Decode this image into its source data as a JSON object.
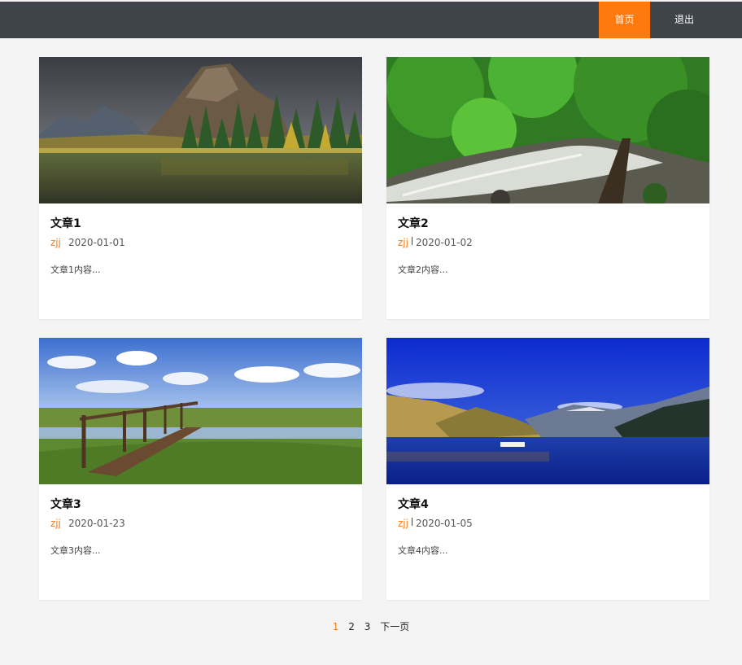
{
  "nav": {
    "home": "首页",
    "logout": "退出"
  },
  "articles": [
    {
      "title": "文章1",
      "author": "zjj",
      "date": "2020-01-01",
      "excerpt": "文章1内容..."
    },
    {
      "title": "文章2",
      "author": "zjj",
      "date": "2020-01-02",
      "excerpt": "文章2内容..."
    },
    {
      "title": "文章3",
      "author": "zjj",
      "date": "2020-01-23",
      "excerpt": "文章3内容..."
    },
    {
      "title": "文章4",
      "author": "zjj",
      "date": "2020-01-05",
      "excerpt": "文章4内容..."
    }
  ],
  "pagination": {
    "pages": [
      "1",
      "2",
      "3"
    ],
    "current": "1",
    "next": "下一页"
  },
  "colors": {
    "topbar": "#3f434a",
    "accent": "#ff7a0e",
    "background": "#f4f4f4"
  }
}
